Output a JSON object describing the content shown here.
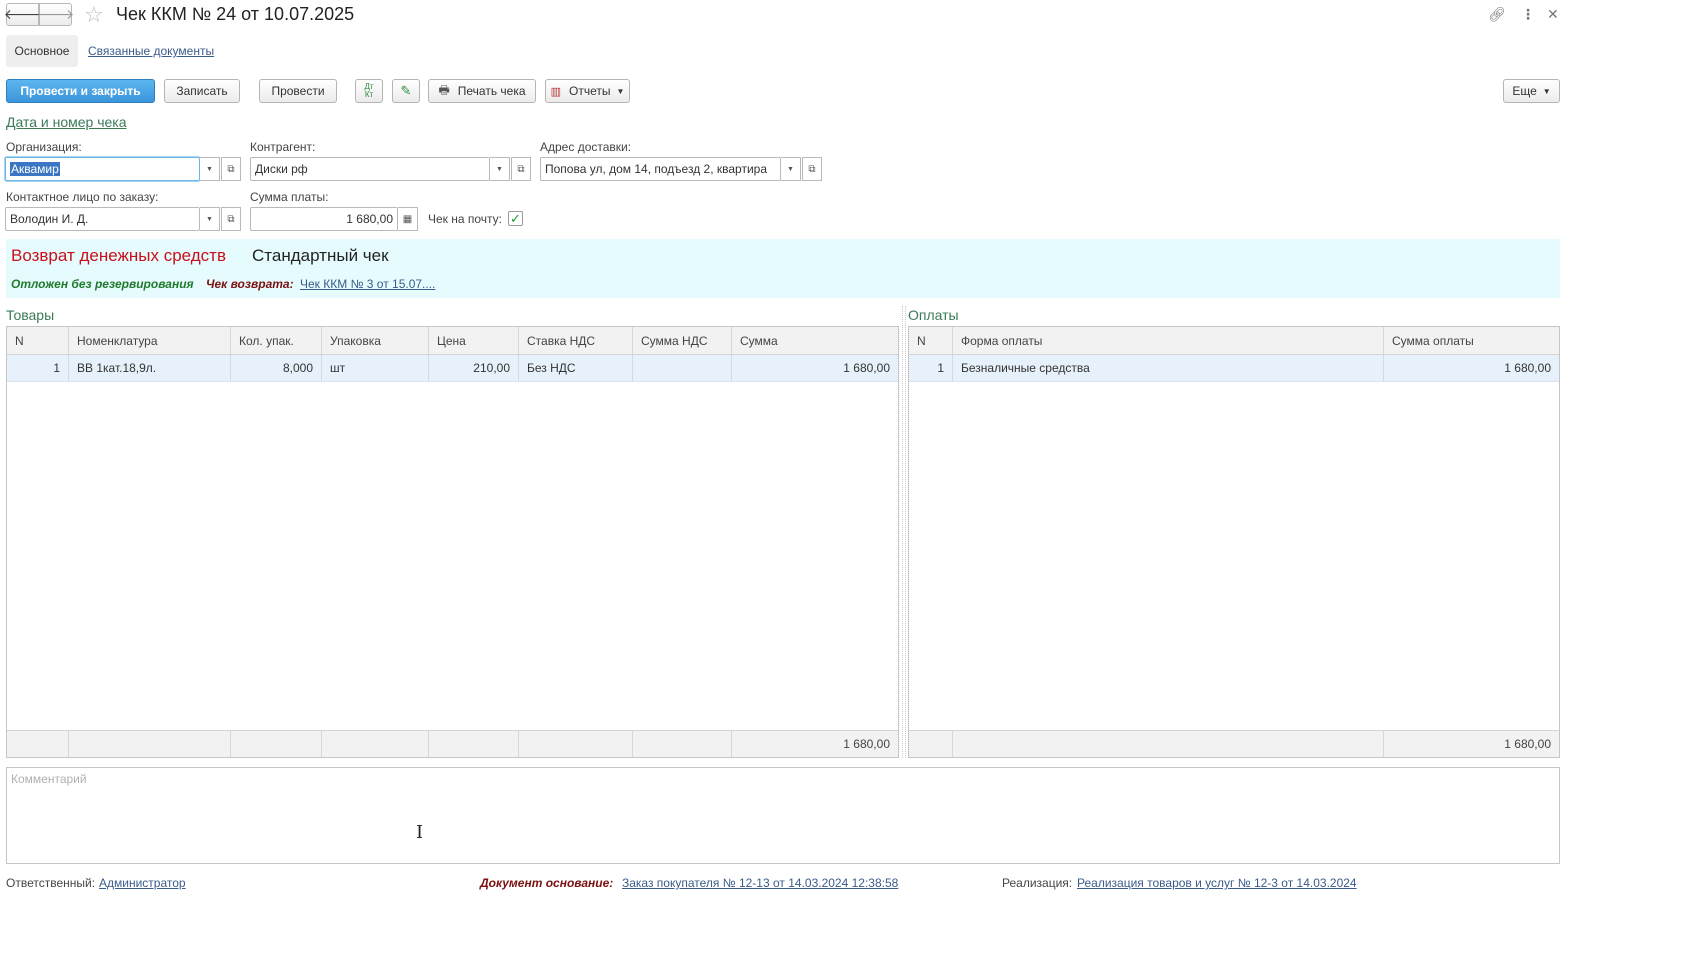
{
  "window": {
    "title": "Чек ККМ № 24 от 10.07.2025",
    "back_icon": "arrow-left-icon",
    "forward_icon": "arrow-right-icon",
    "favorite_icon": "star-icon"
  },
  "tabs": {
    "main": "Основное",
    "related": "Связанные документы"
  },
  "toolbar": {
    "post_and_close": "Провести и закрыть",
    "save": "Записать",
    "post": "Провести",
    "print_receipt": "Печать чека",
    "reports": "Отчеты",
    "more": "Еще"
  },
  "section_link": "Дата и номер чека",
  "fields": {
    "organization_label": "Организация:",
    "organization_value": "Аквамир",
    "counterparty_label": "Контрагент:",
    "counterparty_value": "Диски рф",
    "delivery_label": "Адрес доставки:",
    "delivery_value": "Попова ул,  дом 14,  подъезд 2,  квартира",
    "contact_label": "Контактное лицо по заказу:",
    "contact_value": "Володин И. Д.",
    "payment_sum_label": "Сумма платы:",
    "payment_sum_value": "1 680,00",
    "email_check_label": "Чек на почту:",
    "email_check_checked": true
  },
  "banner": {
    "operation": "Возврат денежных средств",
    "check_type": "Стандартный чек",
    "status": "Отложен без резервирования",
    "return_label": "Чек возврата:",
    "return_link": "Чек ККМ № 3 от 15.07...."
  },
  "goods": {
    "title": "Товары",
    "columns": [
      "N",
      "Номенклатура",
      "Кол. упак.",
      "Упаковка",
      "Цена",
      "Ставка НДС",
      "Сумма НДС",
      "Сумма"
    ],
    "rows": [
      [
        "1",
        "ВВ 1кат.18,9л.",
        "8,000",
        "шт",
        "210,00",
        "Без НДС",
        "",
        "1 680,00"
      ]
    ],
    "total": "1 680,00"
  },
  "payments": {
    "title": "Оплаты",
    "columns": [
      "N",
      "Форма оплаты",
      "Сумма оплаты"
    ],
    "rows": [
      [
        "1",
        "Безналичные средства",
        "1 680,00"
      ]
    ],
    "total": "1 680,00"
  },
  "comment": {
    "placeholder": "Комментарий"
  },
  "footer": {
    "responsible_label": "Ответственный:",
    "responsible_value": "Администратор",
    "basis_label": "Документ основание:",
    "basis_value": "Заказ покупателя № 12-13 от 14.03.2024 12:38:58",
    "realization_label": "Реализация:",
    "realization_value": "Реализация товаров и услуг № 12-3 от 14.03.2024"
  }
}
